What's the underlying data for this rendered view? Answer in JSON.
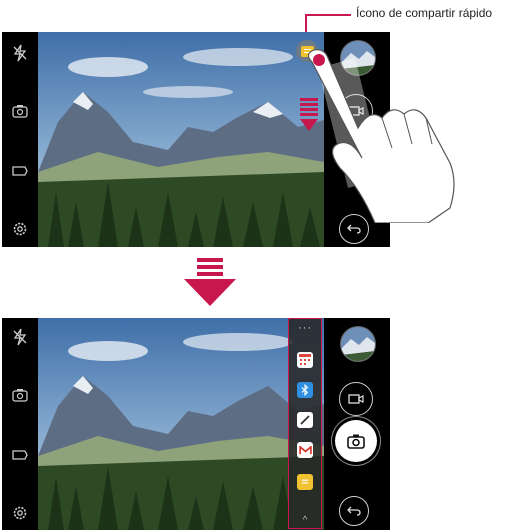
{
  "callout": {
    "label": "Ícono de compartir rápido"
  },
  "colors": {
    "accent": "#c8174d",
    "panel": "#282828",
    "screen_bg": "#000000"
  },
  "top_screen": {
    "left_icons": [
      "flash-off-icon",
      "switch-camera-icon",
      "mode-icon",
      "settings-icon"
    ],
    "right_controls": [
      "gallery-thumbnail",
      "video-record-button",
      "back-button"
    ],
    "quick_share_icon": "message-icon"
  },
  "bottom_screen": {
    "left_icons": [
      "flash-off-icon",
      "switch-camera-icon",
      "mode-icon",
      "settings-icon"
    ],
    "right_controls": [
      "gallery-thumbnail",
      "video-record-button",
      "shutter-button",
      "back-button"
    ],
    "quick_share_panel": {
      "more_label": "···",
      "apps": [
        "calendar-app-icon",
        "bluetooth-app-icon",
        "notes-app-icon",
        "gmail-app-icon",
        "message-app-icon"
      ],
      "collapse_label": "^"
    }
  }
}
